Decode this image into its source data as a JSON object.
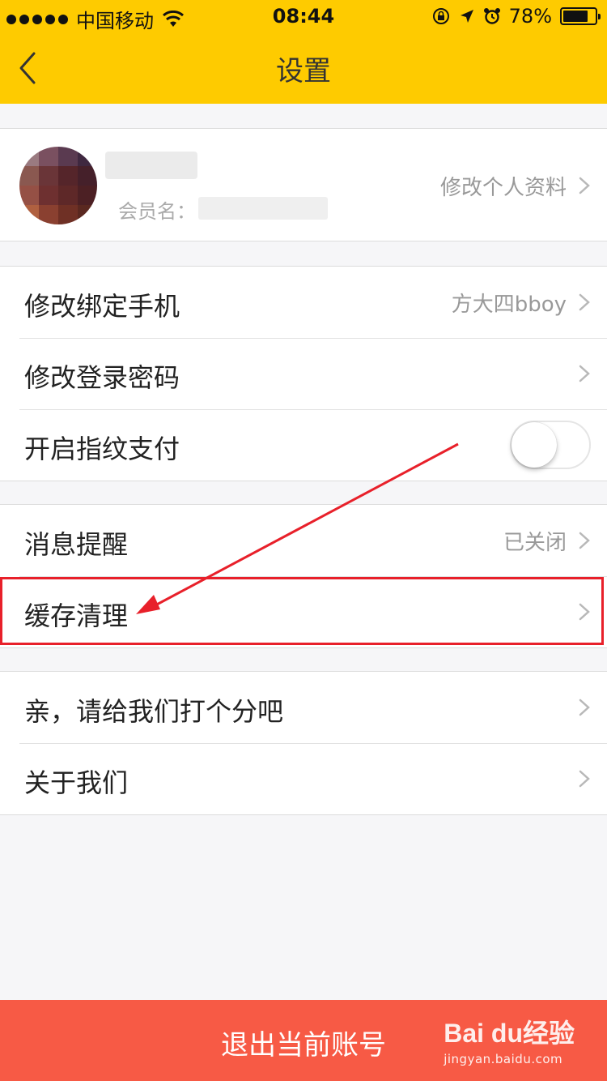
{
  "status_bar": {
    "carrier": "中国移动",
    "time": "08:44",
    "battery": "78%",
    "battery_level": 0.78,
    "icons": [
      "signal-dots-icon",
      "wifi-icon",
      "rotation-lock-icon",
      "location-icon",
      "alarm-icon",
      "battery-icon"
    ]
  },
  "nav": {
    "title": "设置",
    "back_icon": "chevron-left-icon"
  },
  "profile": {
    "member_label": "会员名：",
    "edit_label": "修改个人资料"
  },
  "settings": {
    "bind_phone": {
      "label": "修改绑定手机",
      "value": "方大四bboy"
    },
    "login_password": {
      "label": "修改登录密码"
    },
    "fingerprint_pay": {
      "label": "开启指纹支付",
      "enabled": false
    },
    "notifications": {
      "label": "消息提醒",
      "value": "已关闭"
    },
    "cache_clear": {
      "label": "缓存清理"
    },
    "rate_us": {
      "label": "亲，请给我们打个分吧"
    },
    "about": {
      "label": "关于我们"
    }
  },
  "logout": {
    "label": "退出当前账号"
  },
  "watermark": {
    "brand": "Bai du经验",
    "url": "jingyan.baidu.com"
  },
  "colors": {
    "header": "#fecb00",
    "logout": "#f75a45",
    "annotation": "#e8202a"
  }
}
